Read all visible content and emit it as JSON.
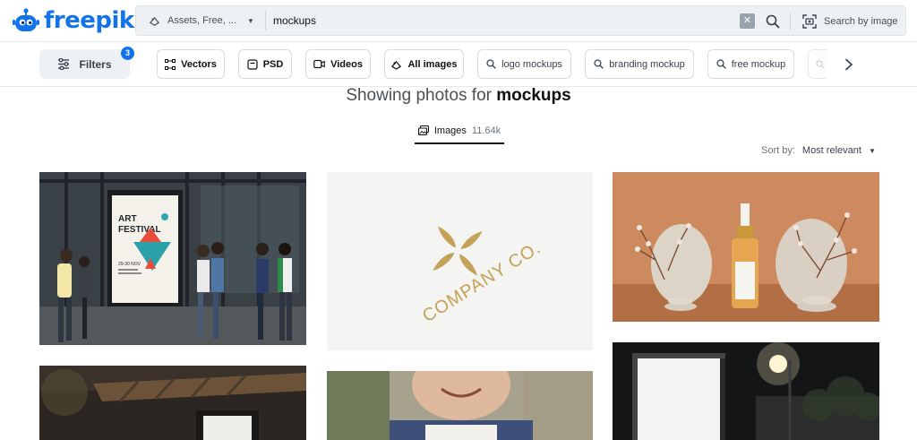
{
  "header": {
    "logo_text": "freepik",
    "search": {
      "asset_filter_label": "Assets, Free, ...",
      "query": "mockups",
      "clear_symbol": "✕",
      "image_search_label": "Search by image"
    }
  },
  "filterbar": {
    "filters_label": "Filters",
    "filters_count": "3",
    "chips": [
      {
        "label": "Vectors",
        "icon": "vector-icon"
      },
      {
        "label": "PSD",
        "icon": "psd-icon"
      },
      {
        "label": "Videos",
        "icon": "video-icon"
      },
      {
        "label": "All images",
        "icon": "images-icon"
      },
      {
        "label": "logo mockups",
        "icon": "search-icon"
      },
      {
        "label": "branding mockup",
        "icon": "search-icon"
      },
      {
        "label": "free mockup",
        "icon": "search-icon"
      }
    ]
  },
  "results": {
    "heading_prefix": "Showing photos for",
    "heading_query": "mockups",
    "tab_label": "Images",
    "tab_count": "11.64k",
    "sort_label": "Sort by:",
    "sort_value": "Most relevant"
  },
  "images": {
    "poster_line1": "ART",
    "poster_line2": "FESTIVAL",
    "poster_date": "29-30 NOV",
    "logo_text": "COMPANY CO."
  },
  "colors": {
    "brand": "#1273eb",
    "search_bg": "#eef1f3",
    "text": "#0e1111",
    "muted": "#6a737b"
  }
}
